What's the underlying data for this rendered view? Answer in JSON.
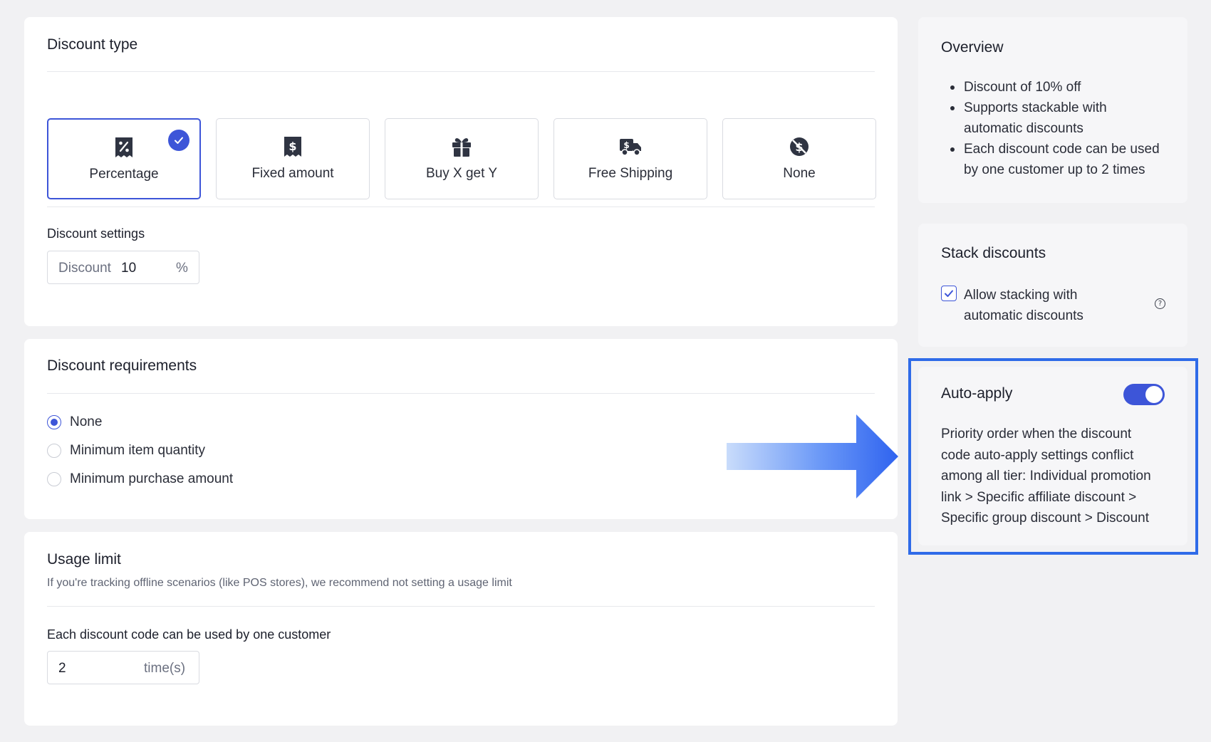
{
  "discount_type": {
    "title": "Discount type",
    "options": [
      {
        "label": "Percentage",
        "icon": "percent-receipt-icon",
        "selected": true
      },
      {
        "label": "Fixed amount",
        "icon": "dollar-receipt-icon",
        "selected": false
      },
      {
        "label": "Buy X get Y",
        "icon": "gift-icon",
        "selected": false
      },
      {
        "label": "Free Shipping",
        "icon": "shipping-truck-icon",
        "selected": false
      },
      {
        "label": "None",
        "icon": "no-dollar-icon",
        "selected": false
      }
    ]
  },
  "discount_settings": {
    "title": "Discount settings",
    "field_label": "Discount",
    "value": "10",
    "unit": "%"
  },
  "discount_requirements": {
    "title": "Discount requirements",
    "options": [
      {
        "label": "None",
        "selected": true
      },
      {
        "label": "Minimum item quantity",
        "selected": false
      },
      {
        "label": "Minimum purchase amount",
        "selected": false
      }
    ]
  },
  "usage_limit": {
    "title": "Usage limit",
    "note": "If you're tracking offline scenarios (like POS stores), we recommend not setting a usage limit",
    "per_customer_label": "Each discount code can be used by one customer",
    "value": "2",
    "unit": "time(s)"
  },
  "overview": {
    "title": "Overview",
    "items": [
      "Discount of 10% off",
      "Supports stackable with automatic discounts",
      "Each discount code can be used by one customer up to 2 times"
    ]
  },
  "stack_discounts": {
    "title": "Stack discounts",
    "checkbox_label": "Allow stacking with automatic discounts",
    "checked": true
  },
  "auto_apply": {
    "title": "Auto-apply",
    "enabled": true,
    "description": "Priority order when the discount code auto-apply settings conflict among all tier: Individual promotion link > Specific affiliate discount > Specific group discount > Discount"
  },
  "colors": {
    "accent": "#3d55d8",
    "highlight_border": "#2f6be8",
    "arrow": "#3b6ef5",
    "background": "#f1f1f3"
  }
}
